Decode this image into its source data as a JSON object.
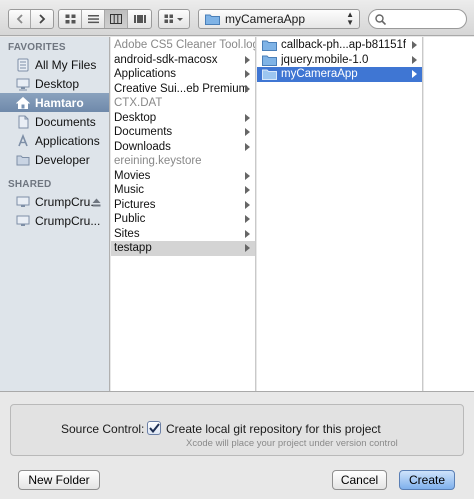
{
  "toolbar": {
    "path_label": "myCameraApp",
    "search_placeholder": ""
  },
  "sidebar": {
    "favorites_header": "FAVORITES",
    "favorites": [
      {
        "label": "All My Files",
        "icon": "all-files-icon"
      },
      {
        "label": "Desktop",
        "icon": "desktop-icon"
      },
      {
        "label": "Hamtaro",
        "icon": "home-icon",
        "selected": true
      },
      {
        "label": "Documents",
        "icon": "documents-icon"
      },
      {
        "label": "Applications",
        "icon": "applications-icon"
      },
      {
        "label": "Developer",
        "icon": "folder-icon"
      }
    ],
    "shared_header": "SHARED",
    "shared": [
      {
        "label": "CrumpCru..."
      },
      {
        "label": "CrumpCru..."
      }
    ]
  },
  "column1": {
    "items": [
      {
        "label": "Adobe CS5 Cleaner Tool.log",
        "dim": true,
        "folder": false
      },
      {
        "label": "android-sdk-macosx",
        "folder": true
      },
      {
        "label": "Applications",
        "folder": true
      },
      {
        "label": "Creative Sui...eb Premium",
        "folder": true
      },
      {
        "label": "CTX.DAT",
        "dim": true,
        "folder": false
      },
      {
        "label": "Desktop",
        "folder": true
      },
      {
        "label": "Documents",
        "folder": true
      },
      {
        "label": "Downloads",
        "folder": true
      },
      {
        "label": "ereining.keystore",
        "dim": true,
        "folder": false
      },
      {
        "label": "Movies",
        "folder": true
      },
      {
        "label": "Music",
        "folder": true
      },
      {
        "label": "Pictures",
        "folder": true
      },
      {
        "label": "Public",
        "folder": true
      },
      {
        "label": "Sites",
        "folder": true
      },
      {
        "label": "testapp",
        "folder": true,
        "selected": true
      }
    ]
  },
  "column2": {
    "items": [
      {
        "label": "callback-ph...ap-b81151f",
        "folder": true
      },
      {
        "label": "jquery.mobile-1.0",
        "folder": true
      },
      {
        "label": "myCameraApp",
        "folder": true,
        "selected": true
      }
    ]
  },
  "source_control": {
    "label": "Source Control:",
    "checkbox_label": "Create local git repository for this project",
    "checked": true,
    "hint": "Xcode will place your project under version control"
  },
  "buttons": {
    "new_folder": "New Folder",
    "cancel": "Cancel",
    "create": "Create"
  }
}
